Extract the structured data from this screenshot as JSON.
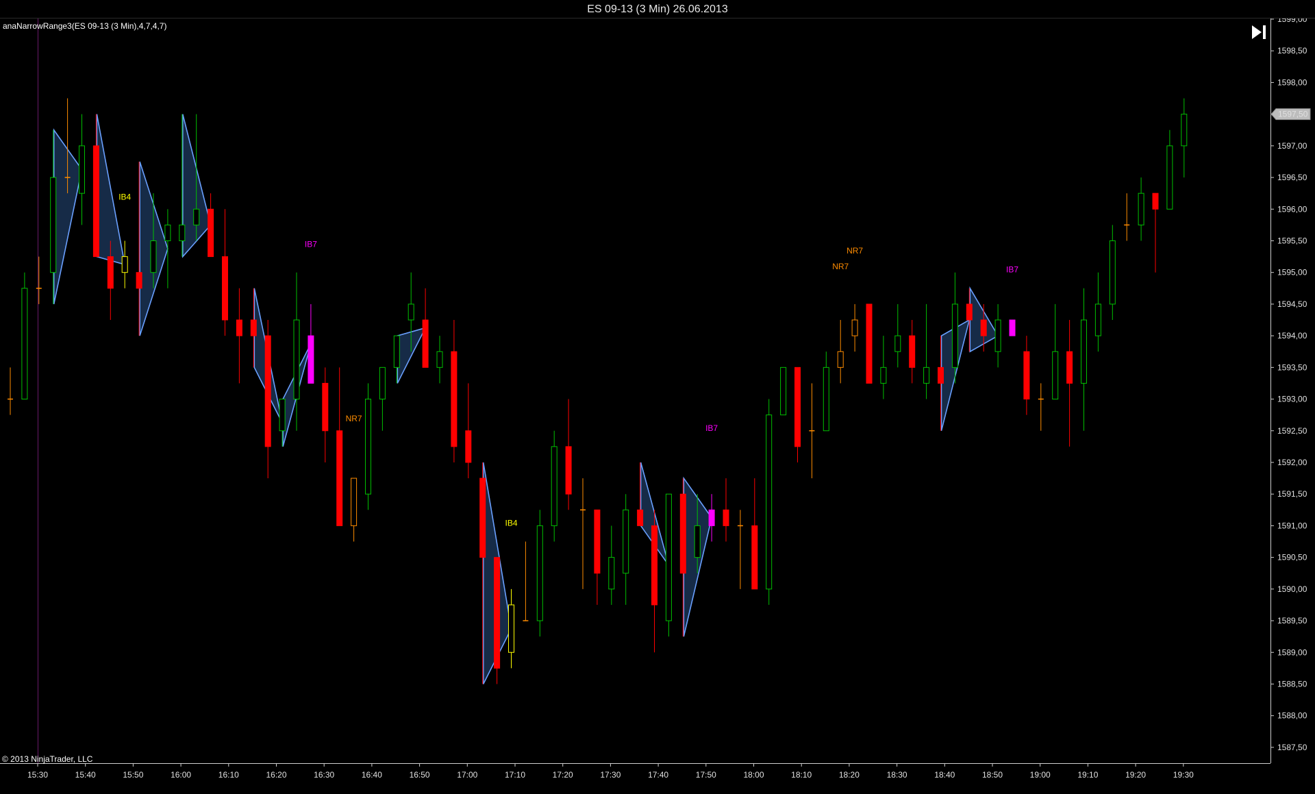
{
  "window": {
    "title": "ES 09-13 (3 Min)  26.06.2013"
  },
  "indicator_label": "anaNarrowRange3(ES 09-13 (3 Min),4,7,4,7)",
  "copyright": "© 2013 NinjaTrader, LLC",
  "colors": {
    "up": "#00c000",
    "down": "#ff0000",
    "narrow_range": "#ff8c00",
    "inside_bar_4": "#ffff00",
    "inside_bar_7": "#ff00ff",
    "triangle_fill": "#1e3a5f",
    "triangle_edge": "#6aa0ff",
    "background": "#000000",
    "axis": "#cccccc"
  },
  "icons": {
    "scroll_end": "skip-to-end-icon"
  },
  "chart_data": {
    "type": "candlestick",
    "title": "ES 09-13 (3 Min)  26.06.2013",
    "ylim": [
      1587.25,
      1599.0
    ],
    "y_ticks": [
      "1587,50",
      "1588,00",
      "1588,50",
      "1589,00",
      "1589,50",
      "1590,00",
      "1590,50",
      "1591,00",
      "1591,50",
      "1592,00",
      "1592,50",
      "1593,00",
      "1593,50",
      "1594,00",
      "1594,50",
      "1595,00",
      "1595,50",
      "1596,00",
      "1596,50",
      "1597,00",
      "1597,50",
      "1598,00",
      "1598,50",
      "1599,00"
    ],
    "x_ticks": [
      "15:30",
      "15:40",
      "15:50",
      "16:00",
      "16:10",
      "16:20",
      "16:30",
      "16:40",
      "16:50",
      "17:00",
      "17:10",
      "17:20",
      "17:30",
      "17:40",
      "17:50",
      "18:00",
      "18:10",
      "18:20",
      "18:30",
      "18:40",
      "18:50",
      "19:00",
      "19:10",
      "19:20",
      "19:30"
    ],
    "last_price": "1597,50",
    "bars": [
      {
        "o": 1593.0,
        "h": 1593.5,
        "l": 1592.75,
        "c": 1593.0,
        "k": "n"
      },
      {
        "o": 1593.0,
        "h": 1595.0,
        "l": 1593.0,
        "c": 1594.75,
        "k": "u"
      },
      {
        "o": 1594.75,
        "h": 1595.25,
        "l": 1594.5,
        "c": 1594.75,
        "k": "n"
      },
      {
        "o": 1595.0,
        "h": 1597.25,
        "l": 1594.5,
        "c": 1596.5,
        "k": "u"
      },
      {
        "o": 1596.5,
        "h": 1597.75,
        "l": 1596.25,
        "c": 1596.5,
        "k": "n"
      },
      {
        "o": 1596.25,
        "h": 1597.5,
        "l": 1595.75,
        "c": 1597.0,
        "k": "u"
      },
      {
        "o": 1597.0,
        "h": 1597.5,
        "l": 1595.25,
        "c": 1595.25,
        "k": "d"
      },
      {
        "o": 1595.25,
        "h": 1595.5,
        "l": 1594.25,
        "c": 1594.75,
        "k": "d"
      },
      {
        "o": 1595.0,
        "h": 1595.5,
        "l": 1594.75,
        "c": 1595.25,
        "k": "b4"
      },
      {
        "o": 1595.0,
        "h": 1596.75,
        "l": 1594.0,
        "c": 1594.75,
        "k": "d"
      },
      {
        "o": 1595.0,
        "h": 1596.25,
        "l": 1594.75,
        "c": 1595.5,
        "k": "u"
      },
      {
        "o": 1595.5,
        "h": 1596.0,
        "l": 1594.75,
        "c": 1595.75,
        "k": "u"
      },
      {
        "o": 1595.5,
        "h": 1597.5,
        "l": 1595.25,
        "c": 1595.75,
        "k": "u"
      },
      {
        "o": 1595.75,
        "h": 1597.5,
        "l": 1595.5,
        "c": 1596.0,
        "k": "u"
      },
      {
        "o": 1596.0,
        "h": 1596.25,
        "l": 1595.25,
        "c": 1595.25,
        "k": "d"
      },
      {
        "o": 1595.25,
        "h": 1596.0,
        "l": 1594.0,
        "c": 1594.25,
        "k": "d"
      },
      {
        "o": 1594.25,
        "h": 1594.75,
        "l": 1593.25,
        "c": 1594.0,
        "k": "d"
      },
      {
        "o": 1594.25,
        "h": 1594.75,
        "l": 1593.5,
        "c": 1594.0,
        "k": "d"
      },
      {
        "o": 1594.0,
        "h": 1594.25,
        "l": 1591.75,
        "c": 1592.25,
        "k": "d"
      },
      {
        "o": 1592.5,
        "h": 1593.0,
        "l": 1592.25,
        "c": 1593.0,
        "k": "u"
      },
      {
        "o": 1593.0,
        "h": 1595.0,
        "l": 1592.5,
        "c": 1594.25,
        "k": "u"
      },
      {
        "o": 1594.0,
        "h": 1594.5,
        "l": 1593.25,
        "c": 1593.25,
        "k": "b7"
      },
      {
        "o": 1593.25,
        "h": 1593.5,
        "l": 1592.0,
        "c": 1592.5,
        "k": "d"
      },
      {
        "o": 1592.5,
        "h": 1593.5,
        "l": 1591.0,
        "c": 1591.0,
        "k": "d"
      },
      {
        "o": 1591.0,
        "h": 1591.75,
        "l": 1590.75,
        "c": 1591.75,
        "k": "nr"
      },
      {
        "o": 1591.5,
        "h": 1593.25,
        "l": 1591.25,
        "c": 1593.0,
        "k": "u"
      },
      {
        "o": 1593.0,
        "h": 1593.5,
        "l": 1592.5,
        "c": 1593.5,
        "k": "u"
      },
      {
        "o": 1593.5,
        "h": 1594.0,
        "l": 1593.25,
        "c": 1594.0,
        "k": "u"
      },
      {
        "o": 1594.25,
        "h": 1595.0,
        "l": 1593.75,
        "c": 1594.5,
        "k": "u"
      },
      {
        "o": 1594.25,
        "h": 1594.75,
        "l": 1593.5,
        "c": 1593.5,
        "k": "d"
      },
      {
        "o": 1593.5,
        "h": 1594.0,
        "l": 1593.25,
        "c": 1593.75,
        "k": "u"
      },
      {
        "o": 1593.75,
        "h": 1594.25,
        "l": 1592.0,
        "c": 1592.25,
        "k": "d"
      },
      {
        "o": 1592.5,
        "h": 1593.25,
        "l": 1591.75,
        "c": 1592.0,
        "k": "d"
      },
      {
        "o": 1591.75,
        "h": 1592.0,
        "l": 1588.5,
        "c": 1590.5,
        "k": "d"
      },
      {
        "o": 1590.5,
        "h": 1590.5,
        "l": 1588.5,
        "c": 1588.75,
        "k": "d"
      },
      {
        "o": 1589.0,
        "h": 1590.0,
        "l": 1588.75,
        "c": 1589.75,
        "k": "b4"
      },
      {
        "o": 1589.5,
        "h": 1590.75,
        "l": 1589.5,
        "c": 1589.5,
        "k": "n"
      },
      {
        "o": 1589.5,
        "h": 1591.25,
        "l": 1589.25,
        "c": 1591.0,
        "k": "u"
      },
      {
        "o": 1591.0,
        "h": 1592.5,
        "l": 1590.75,
        "c": 1592.25,
        "k": "u"
      },
      {
        "o": 1592.25,
        "h": 1593.0,
        "l": 1591.25,
        "c": 1591.5,
        "k": "d"
      },
      {
        "o": 1591.25,
        "h": 1591.75,
        "l": 1590.0,
        "c": 1591.25,
        "k": "n"
      },
      {
        "o": 1591.25,
        "h": 1591.25,
        "l": 1589.75,
        "c": 1590.25,
        "k": "d"
      },
      {
        "o": 1590.0,
        "h": 1591.0,
        "l": 1589.75,
        "c": 1590.5,
        "k": "u"
      },
      {
        "o": 1590.25,
        "h": 1591.5,
        "l": 1589.75,
        "c": 1591.25,
        "k": "u"
      },
      {
        "o": 1591.25,
        "h": 1592.0,
        "l": 1591.0,
        "c": 1591.0,
        "k": "d"
      },
      {
        "o": 1591.0,
        "h": 1591.25,
        "l": 1589.0,
        "c": 1589.75,
        "k": "d"
      },
      {
        "o": 1589.5,
        "h": 1591.5,
        "l": 1589.25,
        "c": 1591.5,
        "k": "u"
      },
      {
        "o": 1591.5,
        "h": 1591.75,
        "l": 1589.25,
        "c": 1590.25,
        "k": "d"
      },
      {
        "o": 1590.5,
        "h": 1591.5,
        "l": 1590.25,
        "c": 1591.0,
        "k": "u"
      },
      {
        "o": 1591.0,
        "h": 1591.5,
        "l": 1590.75,
        "c": 1591.25,
        "k": "b7"
      },
      {
        "o": 1591.25,
        "h": 1591.75,
        "l": 1590.75,
        "c": 1591.0,
        "k": "d"
      },
      {
        "o": 1591.0,
        "h": 1591.25,
        "l": 1590.0,
        "c": 1591.0,
        "k": "n"
      },
      {
        "o": 1591.0,
        "h": 1591.75,
        "l": 1590.0,
        "c": 1590.0,
        "k": "d"
      },
      {
        "o": 1590.0,
        "h": 1593.0,
        "l": 1589.75,
        "c": 1592.75,
        "k": "u"
      },
      {
        "o": 1592.75,
        "h": 1593.5,
        "l": 1592.75,
        "c": 1593.5,
        "k": "u"
      },
      {
        "o": 1593.5,
        "h": 1593.5,
        "l": 1592.0,
        "c": 1592.25,
        "k": "d"
      },
      {
        "o": 1592.5,
        "h": 1593.25,
        "l": 1591.75,
        "c": 1592.5,
        "k": "n"
      },
      {
        "o": 1592.5,
        "h": 1593.75,
        "l": 1592.5,
        "c": 1593.5,
        "k": "u"
      },
      {
        "o": 1593.5,
        "h": 1594.25,
        "l": 1593.25,
        "c": 1593.75,
        "k": "nr"
      },
      {
        "o": 1594.0,
        "h": 1594.5,
        "l": 1593.75,
        "c": 1594.25,
        "k": "nr"
      },
      {
        "o": 1594.5,
        "h": 1594.5,
        "l": 1593.25,
        "c": 1593.25,
        "k": "d"
      },
      {
        "o": 1593.25,
        "h": 1594.0,
        "l": 1593.0,
        "c": 1593.5,
        "k": "u"
      },
      {
        "o": 1593.75,
        "h": 1594.5,
        "l": 1593.5,
        "c": 1594.0,
        "k": "u"
      },
      {
        "o": 1594.0,
        "h": 1594.25,
        "l": 1593.25,
        "c": 1593.5,
        "k": "d"
      },
      {
        "o": 1593.25,
        "h": 1594.5,
        "l": 1593.0,
        "c": 1593.5,
        "k": "u"
      },
      {
        "o": 1593.5,
        "h": 1594.0,
        "l": 1592.5,
        "c": 1593.25,
        "k": "d"
      },
      {
        "o": 1593.5,
        "h": 1595.0,
        "l": 1593.25,
        "c": 1594.5,
        "k": "u"
      },
      {
        "o": 1594.5,
        "h": 1594.75,
        "l": 1593.75,
        "c": 1594.25,
        "k": "d"
      },
      {
        "o": 1594.25,
        "h": 1594.5,
        "l": 1593.75,
        "c": 1594.0,
        "k": "d"
      },
      {
        "o": 1593.75,
        "h": 1594.5,
        "l": 1593.5,
        "c": 1594.25,
        "k": "u"
      },
      {
        "o": 1594.25,
        "h": 1594.25,
        "l": 1594.0,
        "c": 1594.0,
        "k": "b7"
      },
      {
        "o": 1593.75,
        "h": 1594.0,
        "l": 1592.75,
        "c": 1593.0,
        "k": "d"
      },
      {
        "o": 1593.0,
        "h": 1593.25,
        "l": 1592.5,
        "c": 1593.0,
        "k": "n"
      },
      {
        "o": 1593.0,
        "h": 1594.5,
        "l": 1593.0,
        "c": 1593.75,
        "k": "u"
      },
      {
        "o": 1593.75,
        "h": 1594.25,
        "l": 1592.25,
        "c": 1593.25,
        "k": "d"
      },
      {
        "o": 1593.25,
        "h": 1594.75,
        "l": 1592.5,
        "c": 1594.25,
        "k": "u"
      },
      {
        "o": 1594.0,
        "h": 1595.0,
        "l": 1593.75,
        "c": 1594.5,
        "k": "u"
      },
      {
        "o": 1594.5,
        "h": 1595.75,
        "l": 1594.25,
        "c": 1595.5,
        "k": "u"
      },
      {
        "o": 1595.75,
        "h": 1596.25,
        "l": 1595.5,
        "c": 1595.75,
        "k": "n"
      },
      {
        "o": 1595.75,
        "h": 1596.5,
        "l": 1595.5,
        "c": 1596.25,
        "k": "u"
      },
      {
        "o": 1596.25,
        "h": 1596.25,
        "l": 1595.0,
        "c": 1596.0,
        "k": "d"
      },
      {
        "o": 1596.0,
        "h": 1597.25,
        "l": 1596.0,
        "c": 1597.0,
        "k": "u"
      },
      {
        "o": 1597.0,
        "h": 1597.75,
        "l": 1596.5,
        "c": 1597.5,
        "k": "u"
      }
    ],
    "triangles": [
      {
        "from": 3,
        "to": 5
      },
      {
        "from": 6,
        "to": 8
      },
      {
        "from": 9,
        "to": 11
      },
      {
        "from": 12,
        "to": 14
      },
      {
        "from": 17,
        "to": 19
      },
      {
        "from": 19,
        "to": 21
      },
      {
        "from": 27,
        "to": 29
      },
      {
        "from": 33,
        "to": 35
      },
      {
        "from": 44,
        "to": 46
      },
      {
        "from": 47,
        "to": 49
      },
      {
        "from": 65,
        "to": 67
      },
      {
        "from": 67,
        "to": 69
      }
    ],
    "labels": [
      {
        "text": "IB4",
        "bar": 8,
        "price": 1596.15,
        "k": "b4"
      },
      {
        "text": "IB7",
        "bar": 21,
        "price": 1595.4,
        "k": "b7"
      },
      {
        "text": "NR7",
        "bar": 24,
        "price": 1592.65,
        "k": "nr"
      },
      {
        "text": "IB4",
        "bar": 35,
        "price": 1591.0,
        "k": "b4"
      },
      {
        "text": "IB7",
        "bar": 49,
        "price": 1592.5,
        "k": "b7"
      },
      {
        "text": "NR7",
        "bar": 58,
        "price": 1595.05,
        "k": "nr"
      },
      {
        "text": "NR7",
        "bar": 59,
        "price": 1595.3,
        "k": "nr"
      },
      {
        "text": "IB7",
        "bar": 70,
        "price": 1595.0,
        "k": "b7"
      }
    ]
  }
}
